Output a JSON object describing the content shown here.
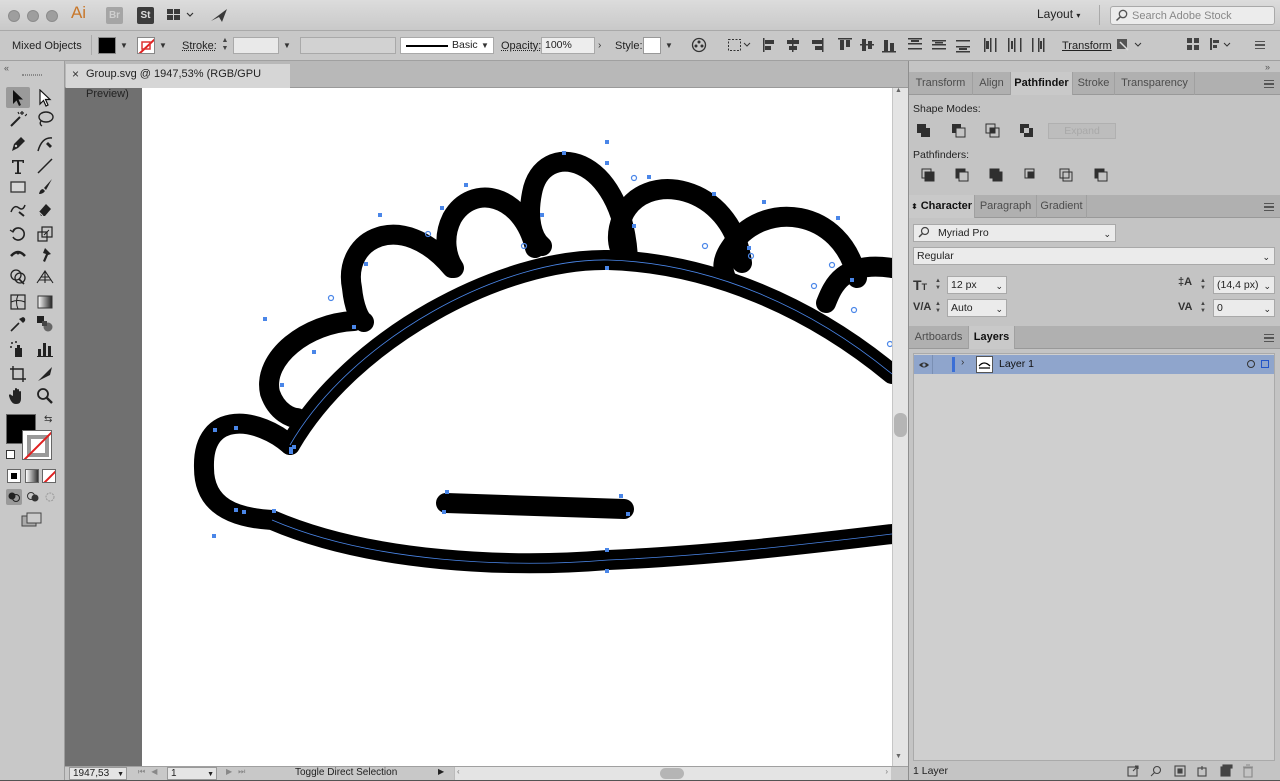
{
  "titlebar": {
    "app_badge": "Ai",
    "bridge_badge": "Br",
    "stock_badge": "St",
    "workspace": "Layout",
    "search_placeholder": "Search Adobe Stock"
  },
  "control_bar": {
    "selection_label": "Mixed Objects",
    "stroke_label": "Stroke:",
    "brush_label": "Basic",
    "opacity_label": "Opacity:",
    "opacity_value": "100%",
    "style_label": "Style:",
    "transform_label": "Transform"
  },
  "document": {
    "tab_title": "Group.svg @ 1947,53% (RGB/GPU Preview)",
    "close_glyph": "×"
  },
  "status_bar": {
    "zoom": "1947,53",
    "artboard_number": "1",
    "status_text": "Toggle Direct Selection"
  },
  "panels": {
    "top_tabs": [
      "Transform",
      "Align",
      "Pathfinder",
      "Stroke",
      "Transparency"
    ],
    "shape_modes_label": "Shape Modes:",
    "expand_label": "Expand",
    "pathfinders_label": "Pathfinders:",
    "mid_tabs": [
      "Character",
      "Paragraph",
      "Gradient"
    ],
    "font_family": "Myriad Pro",
    "font_style": "Regular",
    "font_size": "12 px",
    "leading": "(14,4 px)",
    "kerning": "Auto",
    "tracking": "0",
    "bottom_tabs": [
      "Artboards",
      "Layers"
    ],
    "layer_name": "Layer 1",
    "layer_count": "1 Layer"
  },
  "colors": {
    "selection_blue": "#4a86e8",
    "layer_highlight": "#8fa5cc",
    "fill": "#000000",
    "stroke": "none"
  },
  "icons": [
    "close-icon",
    "search-icon",
    "chevron-down-icon",
    "eye-icon",
    "selection-tool-icon",
    "direct-selection-tool-icon",
    "pen-tool-icon",
    "type-tool-icon",
    "zoom-tool-icon",
    "hand-tool-icon"
  ]
}
